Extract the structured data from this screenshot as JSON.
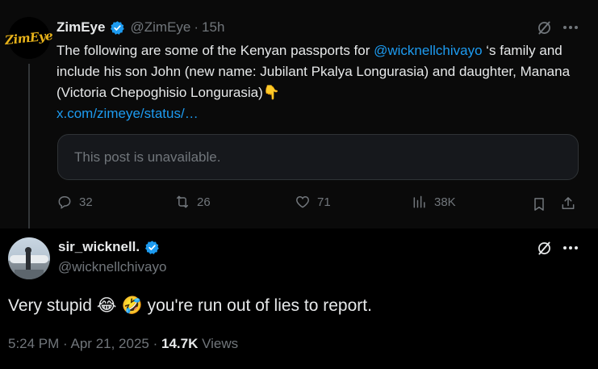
{
  "parent": {
    "avatar_text": "ZimEye",
    "name": "ZimEye",
    "handle": "@ZimEye",
    "separator": "·",
    "time": "15h",
    "text_prefix": "The following are some of the Kenyan passports for ",
    "mention": "@wicknellchivayo",
    "text_suffix": " ‘s family and include his son John (new name: Jubilant Pkalya Longurasia) and daughter, Manana (Victoria Chepoghisio Longurasia)👇",
    "link": "x.com/zimeye/status/…",
    "unavailable": "This post is unavailable.",
    "replies": "32",
    "reposts": "26",
    "likes": "71",
    "views": "38K"
  },
  "reply": {
    "name": "sir_wicknell.",
    "handle": "@wicknellchivayo",
    "text_before": "Very stupid",
    "emoji_1": "😂",
    "emoji_2": "🤣",
    "text_after": "you're run out of lies to report.",
    "time": "5:24 PM",
    "separator": "·",
    "date": "Apr 21, 2025",
    "separator2": "·",
    "views_count": "14.7K",
    "views_label": "Views"
  },
  "colors": {
    "accent": "#1d9bf0",
    "muted": "#71767b",
    "text": "#e7e9ea",
    "background": "#000000"
  },
  "icons": [
    "verified-badge-icon",
    "grok-icon",
    "more-icon",
    "reply-icon",
    "repost-icon",
    "like-icon",
    "views-icon",
    "bookmark-icon",
    "share-icon"
  ]
}
